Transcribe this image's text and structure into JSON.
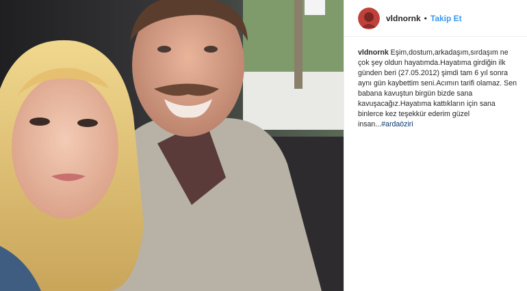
{
  "post": {
    "username": "vldnornk",
    "separator": "•",
    "follow_label": "Takip Et",
    "caption_username": "vldnornk",
    "caption_text": " Eşim,dostum,arkadaşım,sırdaşım ne çok şey oldun hayatımda.Hayatıma girdiğin ilk günden beri (27.05.2012) şimdi tam 6 yıl sonra aynı gün kaybettim seni.Acımın tarifi olamaz. Sen babana kavuştun birgün bizde sana kavuşacağız.Hayatıma kattıkların için sana binlerce kez teşekkür ederim güzel insan...",
    "hashtag": "#ardaöziri"
  },
  "icons": {
    "avatar": "profile-avatar",
    "photo": "selfie-photo"
  },
  "colors": {
    "link": "#3897f0",
    "text": "#262626",
    "hashtag": "#003569",
    "border": "#efefef"
  }
}
